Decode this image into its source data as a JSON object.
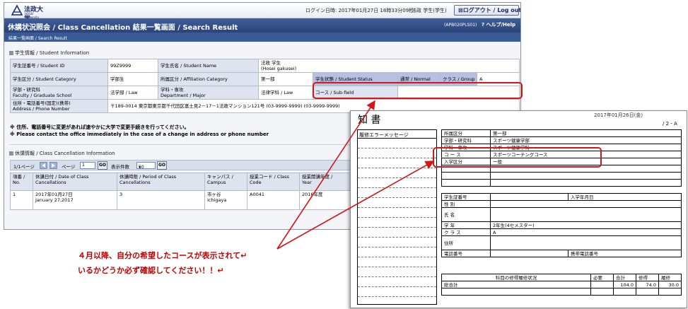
{
  "header": {
    "logo_text": "法政大学",
    "logo_sub": "HOSEI University",
    "login_info": "ログイン日時: 2017年01月27日 18時33分09秒",
    "user": "法政 学生(学生)",
    "logout_label": "ログアウト / Log out"
  },
  "titlebar": {
    "title": "休講状況照会 / Class Cancellation  結果一覧画面 / Search Result",
    "code": "(APB020PLS01)",
    "help": "ヘルプ/Help"
  },
  "breadcrumb": "結果一覧画面 / Search Result",
  "student_info": {
    "heading": "学生情報 / Student Information",
    "rows": [
      [
        "学生証番号 / Student ID",
        "99Z9999",
        "学生氏名 / Student Name",
        "法政 学生",
        "(Hosei gakusei)"
      ],
      [
        "学生区分 / Student Category",
        "学部生",
        "所属区分 / Affiliation Category",
        "第一部",
        "学生状態 / Student Status",
        "通常 / Normal",
        "クラス / Group",
        "A"
      ],
      [
        "学部・研究科",
        "Faculty / Graduate School",
        "法学部 / Law",
        "学科・専攻",
        "Department / Major",
        "法律学科 / Law",
        "コース / Sub-field",
        ""
      ],
      [
        "住所・電話番号(固定)(携帯)",
        "Address / Phone Number",
        "〒189-0014  東京都東京都千代田区富士見2－17－1法政マンション121号  (03-9999-9999)  (03-9999-9999)"
      ]
    ]
  },
  "notes": [
    "※ 住所、電話番号に変更があれば速やかに大学で変更手続きを行ってください。",
    "※ Please contact the office immediately in the case of a change in address or phone number"
  ],
  "cancellation": {
    "heading": "休講情報 / Class Cancellation Information",
    "pager": {
      "page_count": "1/1ページ",
      "page_label": "ページ",
      "page_value": "1",
      "go": "GO",
      "display_label": "表示件数",
      "display_value": "50"
    },
    "headers": [
      [
        "項番 /",
        "No."
      ],
      [
        "休講日付 / Date of Class",
        "Cancellations"
      ],
      [
        "休講時限 / Period of Class",
        "Cancellations"
      ],
      [
        "キャンパス /",
        "Campus"
      ],
      [
        "授業コード / Class",
        "Code"
      ],
      [
        "授業開講年度 /",
        "Year"
      ]
    ],
    "rows": [
      [
        [
          "1",
          ""
        ],
        [
          "2017年01月27日",
          "January 27,2017"
        ],
        [
          "3",
          ""
        ],
        [
          "市ヶ谷",
          "Ichigaya"
        ],
        [
          "A0041",
          ""
        ],
        [
          "2016年度",
          ""
        ]
      ]
    ]
  },
  "document": {
    "title": "知 書",
    "date": "2017年01月26日(金)",
    "page": "/ 2 - A",
    "left_heading": "履修エラーメッセージ",
    "table1": [
      [
        "所属区分",
        "第一部"
      ],
      [
        "学部・研究科",
        "スポーツ健康学部"
      ],
      [
        "学科・専攻",
        "スポーツ健康学科"
      ],
      [
        "コ ー ス",
        "スポーツコーチングコース"
      ],
      [
        "入学区分",
        "一般"
      ]
    ],
    "table2": [
      [
        "学生証番号",
        "",
        "入学年月日"
      ],
      [
        "性 別",
        ""
      ],
      [
        "氏 名",
        ""
      ],
      [
        "学 年",
        "2年生(4セメスター)"
      ],
      [
        "ク ラ ス",
        "A"
      ],
      [
        "住所",
        ""
      ],
      [
        "電話番号",
        "",
        "携帯電話番号"
      ]
    ],
    "table3": {
      "headers": [
        "科目の修得履修状況",
        "必要",
        "合計",
        "修得",
        "履修"
      ],
      "rows": [
        [
          "総合計",
          "",
          "104.0",
          "74.0",
          "30.0"
        ]
      ]
    }
  },
  "caption": [
    "４月以降、自分の希望したコースが表示されて↵",
    "いるかどうか必ず確認してください！！↵"
  ],
  "colors": {
    "title_bar": "#2a4478",
    "annotation": "#d01818"
  }
}
